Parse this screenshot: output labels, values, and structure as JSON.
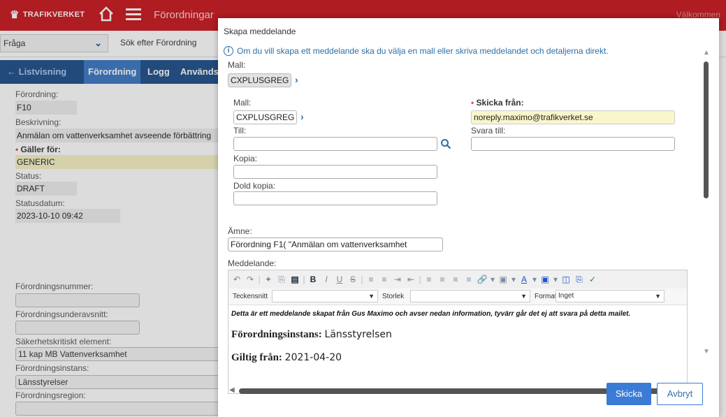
{
  "app": {
    "logo_text": "TRAFIKVERKET",
    "title": "Förordningar",
    "user_partial": "Välkommen"
  },
  "search": {
    "query_value": "Fråga",
    "placeholder": "Sök efter Förordning"
  },
  "tabs": [
    {
      "label": "Listvisning"
    },
    {
      "label": "Förordning"
    },
    {
      "label": "Logg"
    },
    {
      "label": "Används"
    }
  ],
  "record": {
    "forordning_label": "Förordning:",
    "forordning_value": "F10",
    "beskrivning_label": "Beskrivning:",
    "beskrivning_value": "Anmälan om vattenverksamhet avseende förbättring",
    "galler_for_label": "Gäller för:",
    "galler_for_value": "GENERIC",
    "status_label": "Status:",
    "status_value": "DRAFT",
    "statusdatum_label": "Statusdatum:",
    "statusdatum_value": "2023-10-10 09:42",
    "nummer_label": "Förordningsnummer:",
    "underavsnitt_label": "Förordningsunderavsnitt:",
    "sakerhetskritiskt_label": "Säkerhetskritiskt element:",
    "sakerhetskritiskt_value": "11 kap MB Vattenverksamhet",
    "instans_label": "Förordningsinstans:",
    "instans_value": "Länsstyrelser",
    "region_label": "Förordningsregion:"
  },
  "dialog": {
    "title": "Skapa meddelande",
    "info": "Om du vill skapa ett meddelande ska du välja en mall eller skriva meddelandet och detaljerna direkt.",
    "mall_label_top": "Mall:",
    "mall_value_top": "CXPLUSGREG",
    "mall_label": "Mall:",
    "mall_value": "CXPLUSGREG",
    "skicka_fran_label": "Skicka från:",
    "skicka_fran_value": "noreply.maximo@trafikverket.se",
    "till_label": "Till:",
    "svara_till_label": "Svara till:",
    "kopia_label": "Kopia:",
    "dold_kopia_label": "Dold kopia:",
    "amne_label": "Ämne:",
    "amne_value": "Förordning F1(         \"Anmälan om vattenverksamhet",
    "meddelande_label": "Meddelande:",
    "editor": {
      "teckensnitt_label": "Teckensnitt",
      "storlek_label": "Storlek",
      "format_label": "Format",
      "format_value": "Inget",
      "intro": "Detta är ett meddelande skapat från Gus Maximo och avser nedan information, tyvärr går det ej att svara på detta mailet.",
      "line1_label": "Förordningsinstans:",
      "line1_value": "Länsstyrelsen",
      "line2_label": "Giltig från:",
      "line2_value": "2021-04-20"
    },
    "send_button": "Skicka",
    "cancel_button": "Avbryt"
  },
  "colors": {
    "brand_red": "#c8151c",
    "nav_blue": "#1d4e89",
    "accent_blue": "#3a7bd5"
  }
}
